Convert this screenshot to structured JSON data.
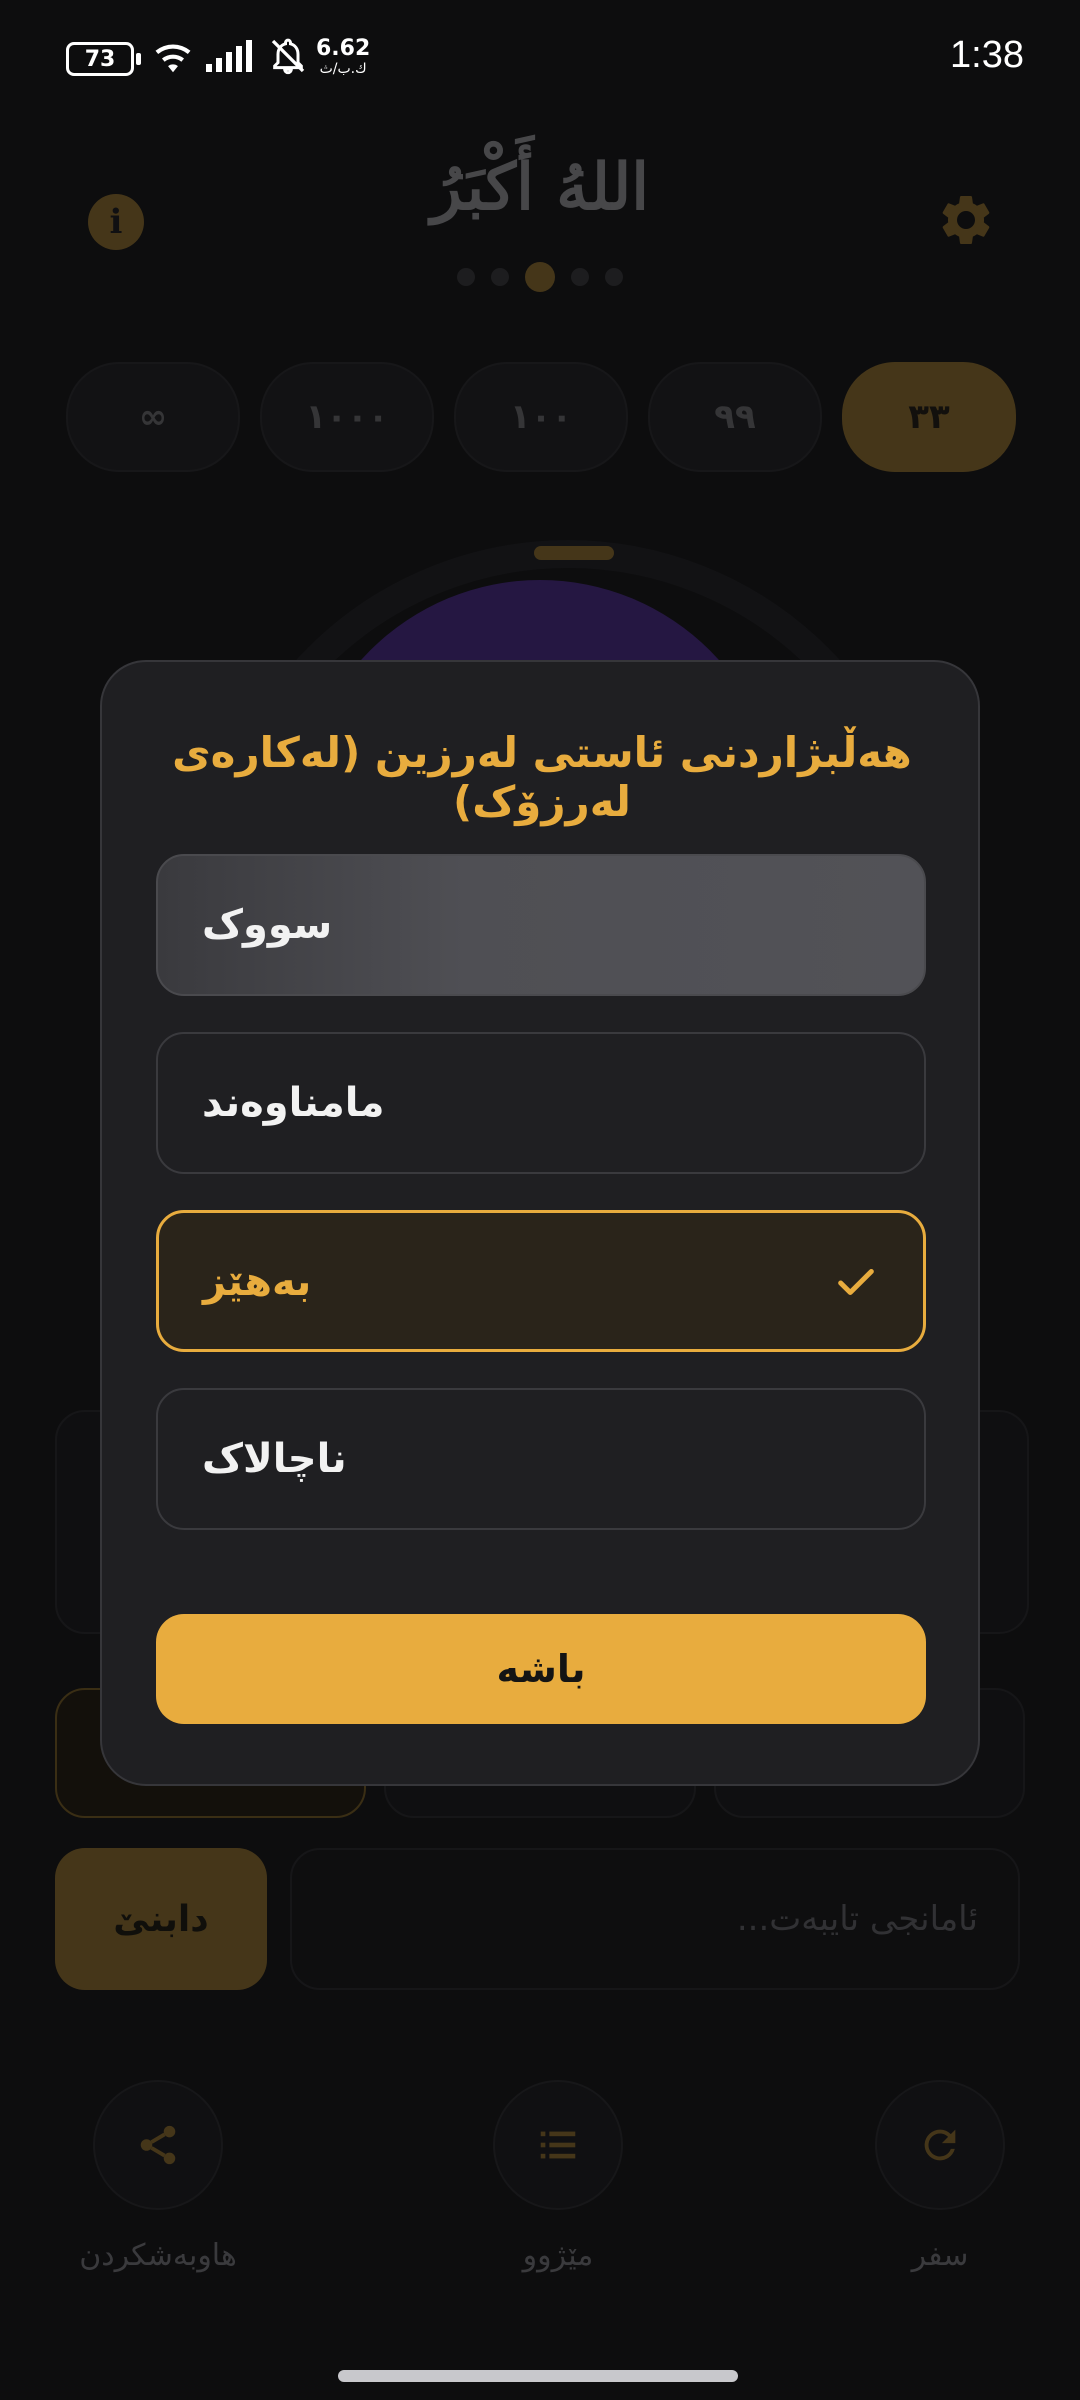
{
  "status_bar": {
    "battery": "73",
    "net_speed_value": "6.62",
    "net_speed_unit": "ك.ب/ث",
    "time": "1:38"
  },
  "header": {
    "title": "اللهُ أَكْبَرُ",
    "info_symbol": "i",
    "page_indicator": {
      "count": 5,
      "active_index": 2
    }
  },
  "count_options": [
    {
      "label": "∞",
      "active": false
    },
    {
      "label": "١٠٠٠",
      "active": false
    },
    {
      "label": "١٠٠",
      "active": false
    },
    {
      "label": "٩٩",
      "active": false
    },
    {
      "label": "٣٣",
      "active": true
    }
  ],
  "goal": {
    "add_label": "دابنێ",
    "input_placeholder": "ئامانجی تایبەت..."
  },
  "bottom_actions": {
    "share_label": "هاوبەشکردن",
    "history_label": "مێژوو",
    "reset_label": "سفر"
  },
  "dialog": {
    "title": "هەڵبژاردنی ئاستی لەرزین (لەکارەی لەرزۆک)",
    "options": [
      {
        "label": "سووک",
        "selected": false
      },
      {
        "label": "مامناوەند",
        "selected": false
      },
      {
        "label": "بەهێز",
        "selected": true
      },
      {
        "label": "ناچالاک",
        "selected": false
      }
    ],
    "ok_label": "باشە"
  },
  "colors": {
    "accent": "#e8ac3e",
    "dim_accent": "#6b5427",
    "background": "#141416",
    "card": "#1f1f22"
  }
}
